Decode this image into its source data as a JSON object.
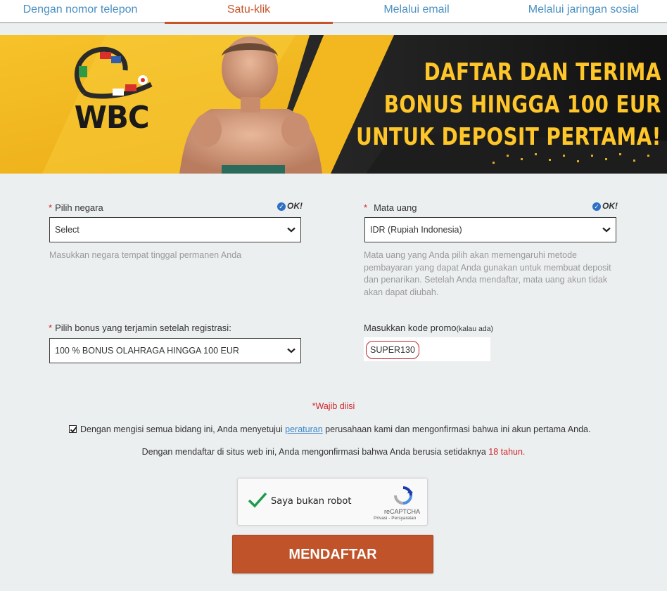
{
  "tabs": [
    {
      "label": "Dengan nomor telepon"
    },
    {
      "label": "Satu-klik",
      "active": true
    },
    {
      "label": "Melalui email"
    },
    {
      "label": "Melalui jaringan sosial"
    }
  ],
  "banner": {
    "logo_text": "WBC",
    "headline": [
      "DAFTAR DAN TERIMA",
      "BONUS HINGGA 100 EUR",
      "UNTUK DEPOSIT PERTAMA!"
    ]
  },
  "form": {
    "required_mark": "*",
    "country": {
      "label": "Pilih negara",
      "ok": "OK!",
      "value": "Select",
      "hint": "Masukkan negara tempat tinggal permanen Anda"
    },
    "currency": {
      "label": "Mata uang",
      "ok": "OK!",
      "value": "IDR (Rupiah Indonesia)",
      "hint": "Mata uang yang Anda pilih akan memengaruhi metode pembayaran yang dapat Anda gunakan untuk membuat deposit dan penarikan. Setelah Anda mendaftar, mata uang akun tidak akan dapat diubah."
    },
    "bonus": {
      "label": "Pilih bonus yang terjamin setelah registrasi:",
      "value": "100 % BONUS OLAHRAGA HINGGA 100 EUR"
    },
    "promo": {
      "label": "Masukkan kode promo",
      "label_suffix": "(kalau ada)",
      "value": "SUPER130"
    },
    "required_note": "*Wajib diisi",
    "agree": {
      "checked": true,
      "before": "Dengan mengisi semua bidang ini, Anda menyetujui ",
      "link": "peraturan",
      "after": " perusahaan kami dan mengonfirmasi bahwa ini akun pertama Anda."
    },
    "age": {
      "text": "Dengan mendaftar di situs web ini, Anda mengonfirmasi bahwa Anda berusia setidaknya ",
      "highlight": "18 tahun."
    },
    "captcha": {
      "label": "Saya bukan robot",
      "brand": "reCAPTCHA",
      "terms": "Privasi - Persyaratan"
    },
    "submit": "MENDAFTAR"
  },
  "colors": {
    "accent": "#c8542b",
    "link": "#4a90c2",
    "banner_yellow": "#ffc629",
    "required": "#d0262a"
  }
}
